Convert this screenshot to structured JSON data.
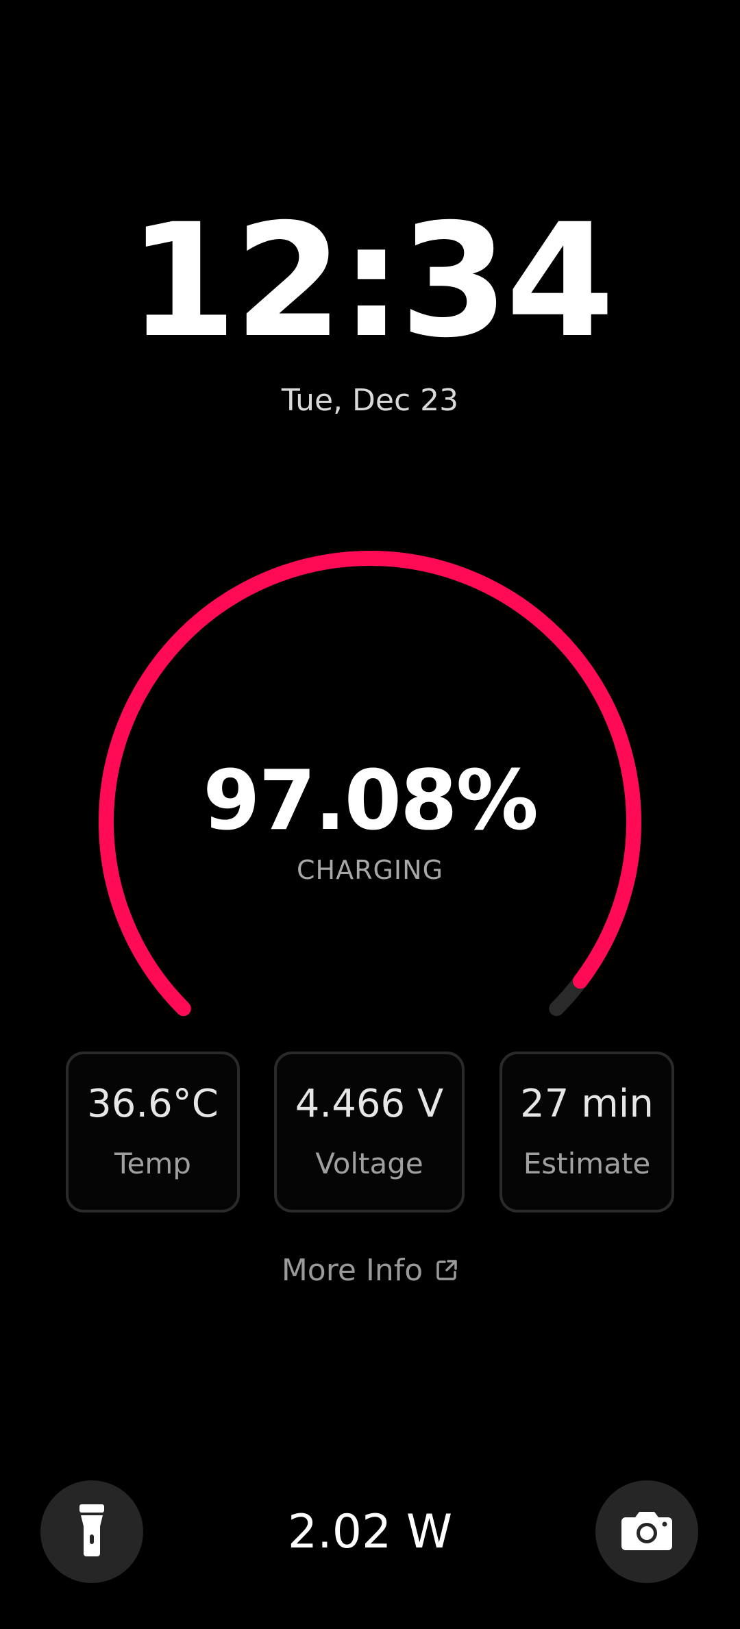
{
  "clock": {
    "time": "12:34",
    "date": "Tue, Dec 23"
  },
  "battery": {
    "percent_text": "97.08%",
    "percent_value": 97.08,
    "status": "CHARGING",
    "accent_color": "#ff0a55",
    "track_color": "#2a2a2a"
  },
  "stats": [
    {
      "value": "36.6°C",
      "label": "Temp"
    },
    {
      "value": "4.466 V",
      "label": "Voltage"
    },
    {
      "value": "27 min",
      "label": "Estimate"
    }
  ],
  "more_info": {
    "label": "More Info",
    "icon": "external-link-icon"
  },
  "bottom_bar": {
    "power": "2.02 W",
    "left_button_icon": "flashlight-icon",
    "right_button_icon": "camera-icon"
  }
}
